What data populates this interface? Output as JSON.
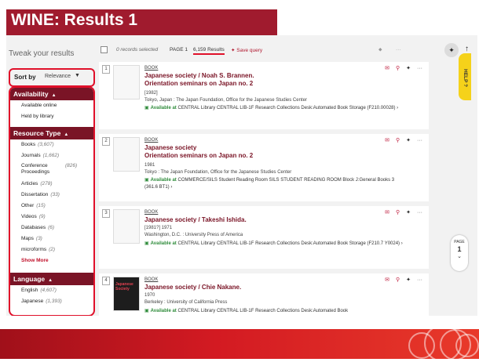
{
  "slide": {
    "title": "WINE: Results 1"
  },
  "toolbar": {
    "records_selected": "0 records selected",
    "page": "PAGE 1",
    "results": "6,159 Results",
    "save_query": "Save query"
  },
  "sidebar": {
    "tweak": "Tweak your results",
    "sort_label": "Sort by",
    "sort_value": "Relevance",
    "availability": {
      "heading": "Availability",
      "items": [
        "Available online",
        "Held by library"
      ]
    },
    "resource_type": {
      "heading": "Resource Type",
      "items": [
        {
          "label": "Books",
          "count": "(3,607)"
        },
        {
          "label": "Journals",
          "count": "(1,662)"
        },
        {
          "label": "Conference Proceedings",
          "count": "(826)"
        },
        {
          "label": "Articles",
          "count": "(278)"
        },
        {
          "label": "Dissertation",
          "count": "(33)"
        },
        {
          "label": "Other",
          "count": "(15)"
        },
        {
          "label": "Videos",
          "count": "(9)"
        },
        {
          "label": "Databases",
          "count": "(6)"
        },
        {
          "label": "Maps",
          "count": "(3)"
        },
        {
          "label": "microforms",
          "count": "(2)"
        }
      ],
      "show_more": "Show More"
    },
    "language": {
      "heading": "Language",
      "items": [
        {
          "label": "English",
          "count": "(4,607)"
        },
        {
          "label": "Japanese",
          "count": "(1,393)"
        }
      ]
    }
  },
  "records": [
    {
      "num": "1",
      "type": "BOOK",
      "title": "Japanese society / Noah S. Brannen.",
      "title2": "Orientation seminars on Japan no. 2",
      "year": "[1982]",
      "pub": "Tokyo, Japan : The Japan Foundation, Office for the Japanese Studies Center",
      "avail": "Available at",
      "loc": "CENTRAL Library  CENTRAL LIB-1F Research Collections Desk:Automated Book Storage (F210.00028)"
    },
    {
      "num": "2",
      "type": "BOOK",
      "title": "Japanese society",
      "title2": "Orientation seminars on Japan no. 2",
      "year": "1981",
      "pub": "Tokyo : The Japan Foundation, Office for the Japanese Studies Center",
      "avail": "Available at",
      "loc": "COMMERCE/SILS Student Reading Room  SILS STUDENT READING ROOM Block J:General Books 3 (361.6 BT1)"
    },
    {
      "num": "3",
      "type": "BOOK",
      "title": "Japanese society / Takeshi Ishida.",
      "title2": "",
      "year": "[1981?] 1971",
      "pub": "Washington, D.C. : University Press of America",
      "avail": "Available at",
      "loc": "CENTRAL Library  CENTRAL LIB-1F Research Collections Desk:Automated Book Storage (F210.7 Y0024)"
    },
    {
      "num": "4",
      "type": "BOOK",
      "title": "Japanese society / Chie Nakane.",
      "title2": "",
      "year": "1970",
      "pub": "Berkeley : University of California Press",
      "avail": "Available at",
      "loc": "CENTRAL Library  CENTRAL LIB-1F Research Collections Desk:Automated Book"
    }
  ],
  "thumb4_text": "Japanese Society",
  "help": "HELP ?",
  "pager": {
    "label": "PAGE",
    "num": "1"
  }
}
